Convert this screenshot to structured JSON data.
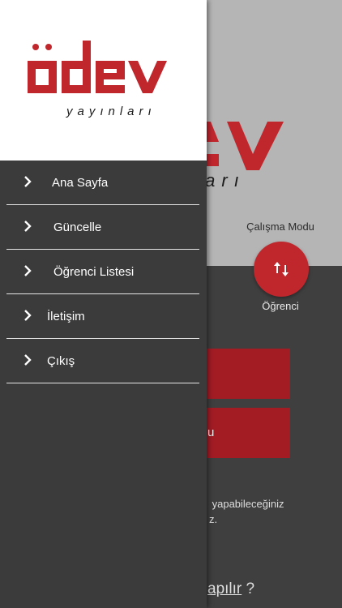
{
  "background": {
    "mode_label": "Çalışma Modu",
    "mode_value": "Öğrenci",
    "button1_label": "",
    "button2_label": "u",
    "description": " yapabileceğiniz\nz.",
    "help_link_prefix": "apılır",
    "help_link_suffix": " ?"
  },
  "menu": {
    "items": [
      {
        "label": "Ana Sayfa",
        "icon": "chevron-right-icon"
      },
      {
        "label": "Güncelle",
        "icon": "chevron-right-icon"
      },
      {
        "label": "Öğrenci Listesi",
        "icon": "chevron-right-icon"
      },
      {
        "label": "İletişim",
        "icon": "chevron-right-icon"
      },
      {
        "label": "Çıkış",
        "icon": "chevron-right-icon"
      }
    ]
  },
  "colors": {
    "brand_red": "#c0272d",
    "button_red": "#a31c24",
    "drawer_bg": "#3b3b3b",
    "bg_gray": "#b5b5b5"
  }
}
